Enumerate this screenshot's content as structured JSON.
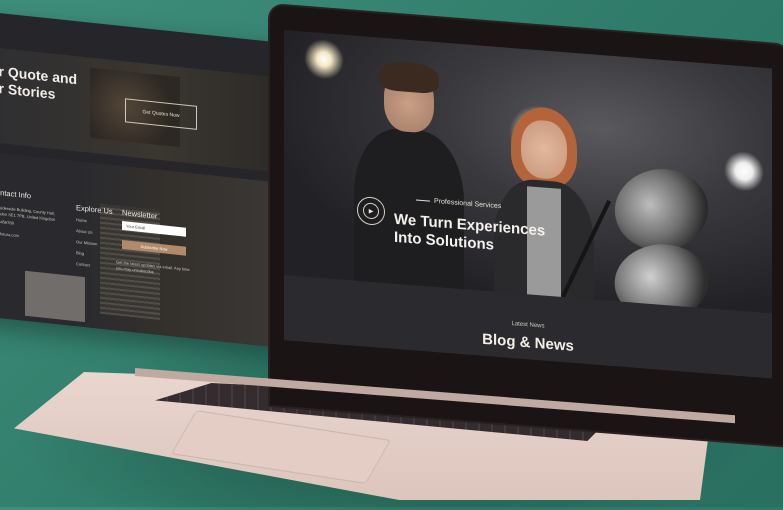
{
  "left_page": {
    "quote_title_line1": "ur Quote and",
    "quote_title_line2": "ur Stories",
    "quote_button": "Get Quotes Now",
    "contact_heading": "ontact Info",
    "contact_lines": [
      "ersiderside Building, County Hall,",
      "ondon SE1 7PB, United Kingdom",
      "23456789",
      "@fotura.com"
    ],
    "explore_heading": "Explore Us",
    "explore_links": [
      "Home",
      "About Us",
      "Our Mission",
      "Blog",
      "Contact"
    ],
    "newsletter_heading": "Newsletter",
    "newsletter_placeholder": "Your Email",
    "newsletter_button": "Subscribe Now",
    "newsletter_note": "Get the latest updates via email. Any time you may unsubscribe"
  },
  "hero": {
    "kicker": "Professional Services",
    "title_line1": "We Turn Experiences",
    "title_line2": "Into Solutions",
    "play_icon": "play-icon"
  },
  "news_section": {
    "kicker": "Latest News",
    "title": "Blog & News"
  }
}
